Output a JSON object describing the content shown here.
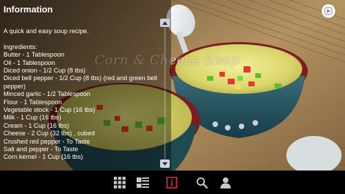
{
  "panel": {
    "title": "Information",
    "intro": "A quick and easy soup recipe.",
    "ingredients_heading": "Ingredients:",
    "ingredients": [
      "Butter - 1 Tablespoon",
      "Oil - 1 Tablespoon",
      "Diced onion - 1/2 Cup (8 tbs)",
      "Diced bell pepper - 1/2 Cup (8 tbs)  (red and green bell",
      "pepper)",
      "Minced garlic - 1/2 Tablespoon",
      "Flour - 1 Tablespoon",
      "Vegetable stock - 1 Cup (16 tbs)",
      "Milk - 1 Cup (16 tbs)",
      "Cream - 1 Cup (16 tbs)",
      "Cheese - 2 Cup (32 tbs) , cubed",
      "Crushed red pepper -  To Taste",
      "Salt and pepper -  To Taste",
      "Corn kernel - 1 Cup (16 tbs)"
    ]
  },
  "overlay": {
    "recipe_title": "Corn & Cheese Soup"
  },
  "icons": {
    "scroll_up": "chevron-up-icon",
    "scroll_down": "chevron-down-icon",
    "logo": "play-logo-icon",
    "nav": [
      "grid-icon",
      "list-icon",
      "info-icon",
      "search-icon",
      "user-icon"
    ]
  },
  "colors": {
    "info_active": "#e0193a",
    "nav_icon": "#c8c8c8",
    "scroll_arrow": "#2a2f5a"
  }
}
